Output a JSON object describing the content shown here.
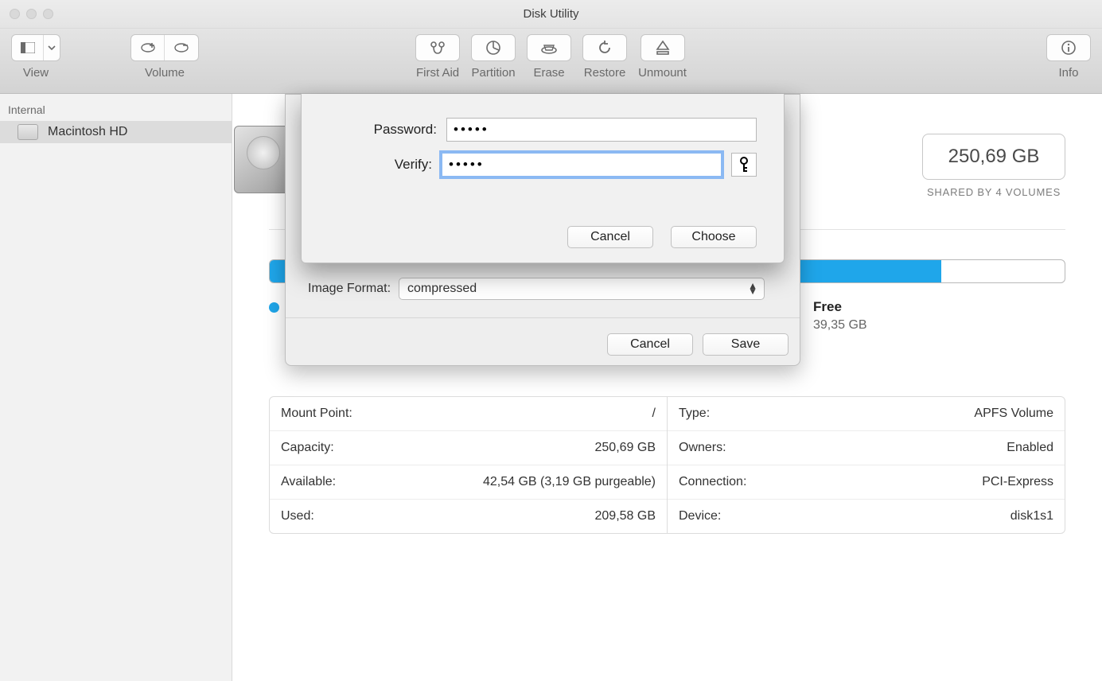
{
  "window": {
    "title": "Disk Utility"
  },
  "toolbar": {
    "view": "View",
    "volume": "Volume",
    "first_aid": "First Aid",
    "partition": "Partition",
    "erase": "Erase",
    "restore": "Restore",
    "unmount": "Unmount",
    "info": "Info"
  },
  "sidebar": {
    "section": "Internal",
    "items": [
      {
        "label": "Macintosh HD"
      }
    ]
  },
  "volume": {
    "size": "250,69 GB",
    "shared_caption": "SHARED BY 4 VOLUMES",
    "free_label": "Free",
    "free_value": "39,35 GB"
  },
  "info": {
    "left": [
      {
        "k": "Mount Point:",
        "v": "/"
      },
      {
        "k": "Capacity:",
        "v": "250,69 GB"
      },
      {
        "k": "Available:",
        "v": "42,54 GB (3,19 GB purgeable)"
      },
      {
        "k": "Used:",
        "v": "209,58 GB"
      }
    ],
    "right": [
      {
        "k": "Type:",
        "v": "APFS Volume"
      },
      {
        "k": "Owners:",
        "v": "Enabled"
      },
      {
        "k": "Connection:",
        "v": "PCI-Express"
      },
      {
        "k": "Device:",
        "v": "disk1s1"
      }
    ]
  },
  "image_sheet": {
    "format_label": "Image Format:",
    "format_value": "compressed",
    "cancel": "Cancel",
    "save": "Save"
  },
  "password_sheet": {
    "password_label": "Password:",
    "verify_label": "Verify:",
    "password_value": "•••••",
    "verify_value": "•••••",
    "cancel": "Cancel",
    "choose": "Choose"
  }
}
